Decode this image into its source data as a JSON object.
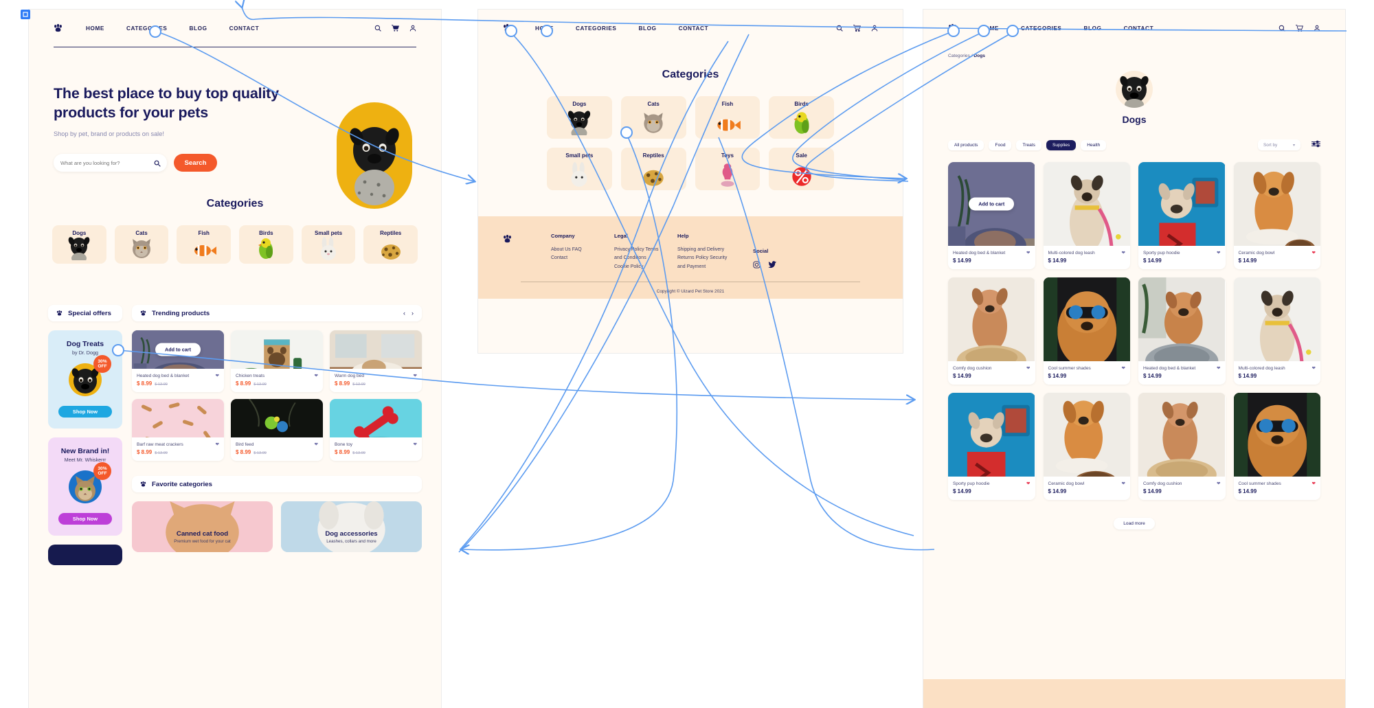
{
  "canvas": {
    "selection_icon": "frame-icon"
  },
  "colors": {
    "cream": "#fffaf4",
    "peach": "#fceddb",
    "navy": "#19195c",
    "orange": "#f4592b",
    "link_blue": "#5b9bf0",
    "yellow": "#eeb111"
  },
  "screen1": {
    "nav": {
      "logo": "paw-logo",
      "items": [
        "HOME",
        "CATEGORIES",
        "BLOG",
        "CONTACT"
      ],
      "icons": [
        "search-icon",
        "cart-icon",
        "user-icon"
      ]
    },
    "hero": {
      "title": "The best place to buy top quality products for your pets",
      "subtitle": "Shop by pet, brand or products on sale!",
      "search_placeholder": "What are you looking for?",
      "search_value": "",
      "search_button": "Search"
    },
    "categories_title": "Categories",
    "categories": [
      "Dogs",
      "Cats",
      "Fish",
      "Birds",
      "Small pets",
      "Reptiles"
    ],
    "special_offers": {
      "title": "Special offers"
    },
    "promos": [
      {
        "title": "Dog Treats",
        "by": "by Dr. Dogg",
        "badge": "30% OFF",
        "cta": "Shop Now",
        "theme": "blue"
      },
      {
        "title": "New Brand in!",
        "by": "Meet Mr. Whiskerrr",
        "badge": "30% OFF",
        "cta": "Shop Now",
        "theme": "pink"
      }
    ],
    "trending": {
      "title": "Trending products",
      "prev": "‹",
      "next": "›",
      "add_to_cart": "Add to cart",
      "products": [
        {
          "name": "Heated dog bed & blanket",
          "price": "$ 8.99",
          "old_price": "$ 13.99",
          "featured": true
        },
        {
          "name": "Chicken treats",
          "price": "$ 8.99",
          "old_price": "$ 13.99",
          "featured": false
        },
        {
          "name": "Warm dog bed",
          "price": "$ 8.99",
          "old_price": "$ 13.99",
          "featured": false
        },
        {
          "name": "Barf raw meat crackers",
          "price": "$ 8.99",
          "old_price": "$ 13.99",
          "featured": false
        },
        {
          "name": "Bird feed",
          "price": "$ 8.99",
          "old_price": "$ 13.99",
          "featured": false
        },
        {
          "name": "Bone toy",
          "price": "$ 8.99",
          "old_price": "$ 13.99",
          "featured": false
        }
      ]
    },
    "favorites": {
      "title": "Favorite categories",
      "cards": [
        {
          "title": "Canned cat food",
          "sub": "Premium wet food for your cat",
          "theme": "pink"
        },
        {
          "title": "Dog accessories",
          "sub": "Leashes, collars and more",
          "theme": "blue"
        }
      ]
    }
  },
  "screen2": {
    "nav": {
      "logo": "paw-logo",
      "items": [
        "HOME",
        "CATEGORIES",
        "BLOG",
        "CONTACT"
      ],
      "icons": [
        "search-icon",
        "cart-icon",
        "user-icon"
      ]
    },
    "title": "Categories",
    "categories": [
      "Dogs",
      "Cats",
      "Fish",
      "Birds",
      "Small pets",
      "Reptiles",
      "Toys",
      "Sale"
    ],
    "footer": {
      "logo": "paw-logo",
      "columns": [
        {
          "heading": "Company",
          "links": [
            "About Us FAQ",
            "Contact"
          ]
        },
        {
          "heading": "Legal",
          "links": [
            "Privacy Policy Terms",
            "and Conditions",
            "Cookie Policy"
          ]
        },
        {
          "heading": "Help",
          "links": [
            "Shipping and Delivery",
            "Returns Policy Security",
            "and Payment"
          ]
        }
      ],
      "social": {
        "heading": "Social",
        "icons": [
          "instagram-icon",
          "twitter-icon"
        ]
      },
      "copyright": "Copyright © Uizard Pet Store 2021"
    }
  },
  "screen3": {
    "nav": {
      "logo": "paw-logo",
      "items": [
        "HOME",
        "CATEGORIES",
        "BLOG",
        "CONTACT"
      ],
      "icons": [
        "search-icon",
        "cart-icon",
        "user-icon"
      ]
    },
    "breadcrumb": {
      "parent": "Categories /",
      "current": "Dogs"
    },
    "page_title": "Dogs",
    "filters": [
      "All products",
      "Food",
      "Treats",
      "Supplies",
      "Health"
    ],
    "active_filter": "Supplies",
    "sort": {
      "label": "Sort by",
      "chevron": "⌄"
    },
    "filter_icon": "sliders-icon",
    "add_to_cart": "Add to cart",
    "load_more": "Load more",
    "products": [
      {
        "name": "Heated dog bed & blanket",
        "price": "$ 14.99",
        "art": "bed-purple",
        "featured": true,
        "liked": false
      },
      {
        "name": "Multi-colored dog leash",
        "price": "$ 14.99",
        "art": "jump-dog",
        "featured": false,
        "liked": false
      },
      {
        "name": "Sporty pup hoodie",
        "price": "$ 14.99",
        "art": "red-hoodie",
        "featured": false,
        "liked": false
      },
      {
        "name": "Ceramic dog bowl",
        "price": "$ 14.99",
        "art": "bowl-dog",
        "featured": false,
        "liked": true
      },
      {
        "name": "Comfy dog cushion",
        "price": "$ 14.99",
        "art": "sit-dog",
        "featured": false,
        "liked": false
      },
      {
        "name": "Cool summer shades",
        "price": "$ 14.99",
        "art": "shades-dog",
        "featured": false,
        "liked": false
      },
      {
        "name": "Heated dog bed & blanket",
        "price": "$ 14.99",
        "art": "grey-bed",
        "featured": false,
        "liked": false
      },
      {
        "name": "Multi-colored dog leash",
        "price": "$ 14.99",
        "art": "jump-dog",
        "featured": false,
        "liked": false
      },
      {
        "name": "Sporty pup hoodie",
        "price": "$ 14.99",
        "art": "red-hoodie",
        "featured": false,
        "liked": true
      },
      {
        "name": "Ceramic dog bowl",
        "price": "$ 14.99",
        "art": "bowl-dog",
        "featured": false,
        "liked": false
      },
      {
        "name": "Comfy dog cushion",
        "price": "$ 14.99",
        "art": "sit-dog",
        "featured": false,
        "liked": false
      },
      {
        "name": "Cool summer shades",
        "price": "$ 14.99",
        "art": "shades-dog",
        "featured": false,
        "liked": true
      }
    ]
  }
}
